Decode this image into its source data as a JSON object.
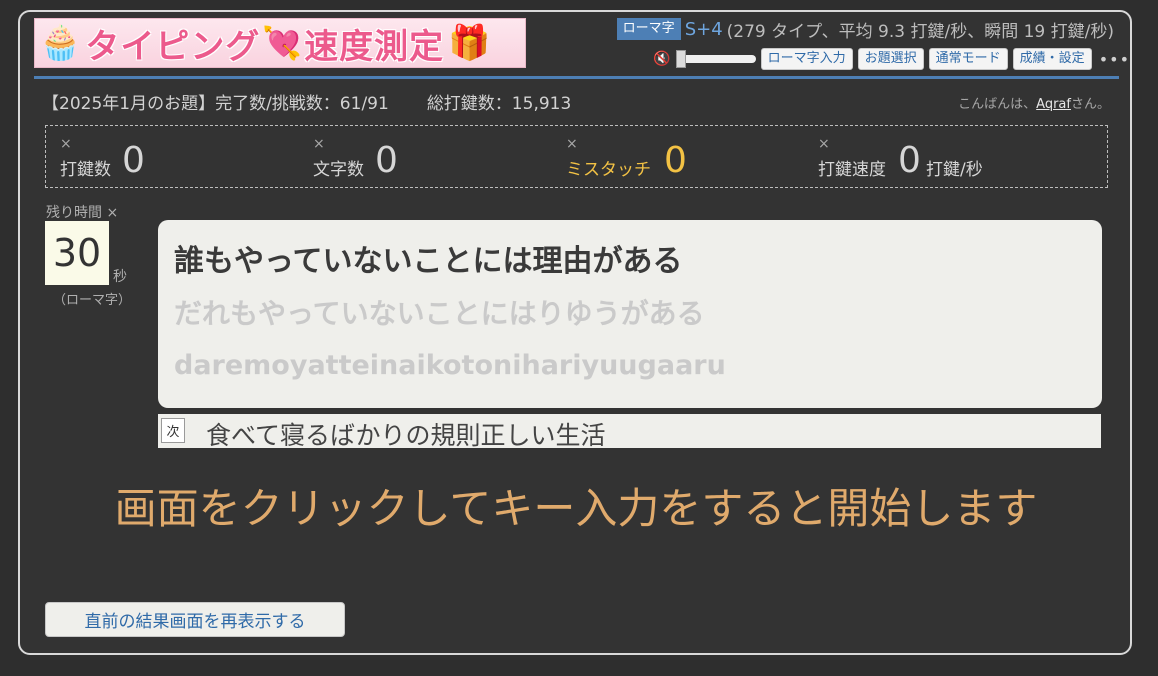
{
  "logo": {
    "text_left": "タイピング",
    "text_right": "速度測定"
  },
  "header": {
    "mode_badge": "ローマ字",
    "rank": "S+4",
    "rank_detail": "(279 タイプ、平均 9.3 打鍵/秒、瞬間 19 打鍵/秒)",
    "speaker_icon": "speaker-mute-icon",
    "buttons": [
      "ローマ字入力",
      "お題選択",
      "通常モード",
      "成績・設定"
    ],
    "more": "•••"
  },
  "info": {
    "challenge": "【2025年1月のお題】完了数/挑戦数：61/91",
    "total_keys": "総打鍵数：15,913",
    "greeting_prefix": "こんばんは、",
    "user": "Aqraf",
    "greeting_suffix": "さん。"
  },
  "stats": [
    {
      "label": "打鍵数",
      "value": "0",
      "unit": ""
    },
    {
      "label": "文字数",
      "value": "0",
      "unit": ""
    },
    {
      "label": "ミスタッチ",
      "value": "0",
      "unit": ""
    },
    {
      "label": "打鍵速度",
      "value": "0",
      "unit": "打鍵/秒"
    }
  ],
  "stat_close": "×",
  "timer": {
    "label": "残り時間 ×",
    "value": "30",
    "unit": "秒",
    "note": "（ローマ字）"
  },
  "prompt": {
    "main": "誰もやっていないことには理由がある",
    "kana": "だれもやっていないことにはりゆうがある",
    "romaji": "daremoyatteinaikotonihariyuugaaru"
  },
  "next": {
    "tag": "次",
    "text": "食べて寝るばかりの規則正しい生活"
  },
  "start_message": "画面をクリックしてキー入力をすると開始します",
  "replay_button": "直前の結果画面を再表示する",
  "colors": {
    "accent_blue": "#4d7fb5",
    "miss_yellow": "#f3c244",
    "start_orange": "#e0aa6c"
  }
}
